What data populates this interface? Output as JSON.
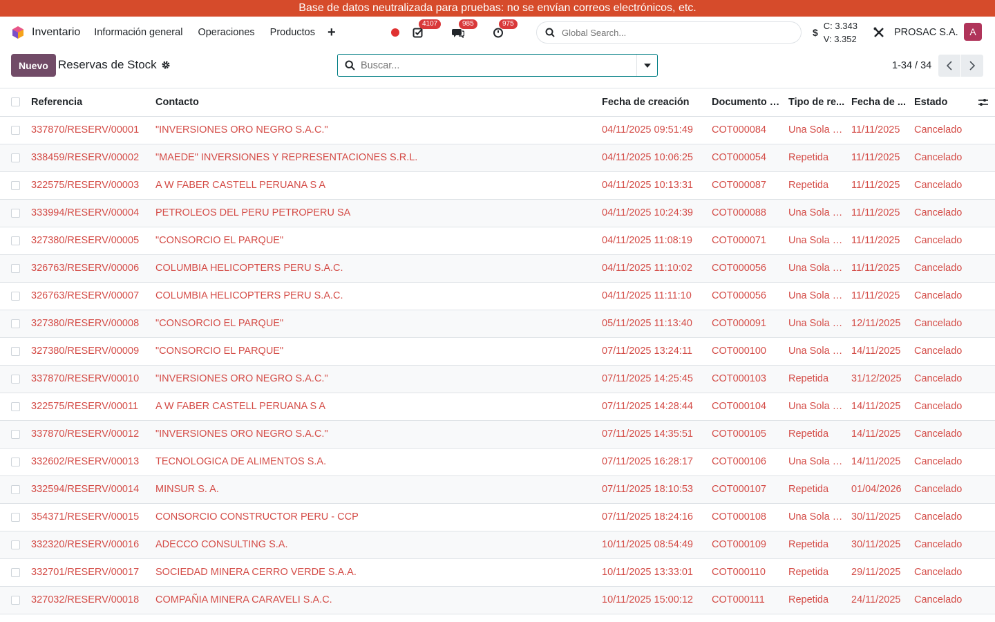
{
  "banner": "Base de datos neutralizada para pruebas: no se envían correos electrónicos, etc.",
  "navbar": {
    "app_name": "Inventario",
    "menu": [
      "Información general",
      "Operaciones",
      "Productos"
    ],
    "activities_badge": "4107",
    "messages_badge": "985",
    "timer_badge": "975",
    "global_search_placeholder": "Global Search...",
    "rate_c": "C: 3.343",
    "rate_v": "V: 3.352",
    "company": "PROSAC S.A.",
    "avatar_letter": "A"
  },
  "control": {
    "new_label": "Nuevo",
    "title": "Reservas de Stock",
    "search_placeholder": "Buscar...",
    "pager": "1-34 / 34"
  },
  "colors": {
    "accent": "#714b67",
    "link_red": "#d44c47",
    "banner": "#d64b2b",
    "teal": "#017e84"
  },
  "table": {
    "headers": [
      "Referencia",
      "Contacto",
      "Fecha de creación",
      "Documento o...",
      "Tipo de re...",
      "Fecha de ...",
      "Estado"
    ],
    "rows": [
      [
        "337870/RESERV/00001",
        "\"INVERSIONES ORO NEGRO S.A.C.\"",
        "04/11/2025 09:51:49",
        "COT000084",
        "Una Sola V...",
        "11/11/2025",
        "Cancelado"
      ],
      [
        "338459/RESERV/00002",
        "\"MAEDE\" INVERSIONES Y REPRESENTACIONES S.R.L.",
        "04/11/2025 10:06:25",
        "COT000054",
        "Repetida",
        "11/11/2025",
        "Cancelado"
      ],
      [
        "322575/RESERV/00003",
        "A W FABER CASTELL PERUANA S A",
        "04/11/2025 10:13:31",
        "COT000087",
        "Repetida",
        "11/11/2025",
        "Cancelado"
      ],
      [
        "333994/RESERV/00004",
        "PETROLEOS DEL PERU PETROPERU SA",
        "04/11/2025 10:24:39",
        "COT000088",
        "Una Sola V...",
        "11/11/2025",
        "Cancelado"
      ],
      [
        "327380/RESERV/00005",
        "\"CONSORCIO EL PARQUE\"",
        "04/11/2025 11:08:19",
        "COT000071",
        "Una Sola V...",
        "11/11/2025",
        "Cancelado"
      ],
      [
        "326763/RESERV/00006",
        "COLUMBIA HELICOPTERS PERU S.A.C.",
        "04/11/2025 11:10:02",
        "COT000056",
        "Una Sola V...",
        "11/11/2025",
        "Cancelado"
      ],
      [
        "326763/RESERV/00007",
        "COLUMBIA HELICOPTERS PERU S.A.C.",
        "04/11/2025 11:11:10",
        "COT000056",
        "Una Sola V...",
        "11/11/2025",
        "Cancelado"
      ],
      [
        "327380/RESERV/00008",
        "\"CONSORCIO EL PARQUE\"",
        "05/11/2025 11:13:40",
        "COT000091",
        "Una Sola V...",
        "12/11/2025",
        "Cancelado"
      ],
      [
        "327380/RESERV/00009",
        "\"CONSORCIO EL PARQUE\"",
        "07/11/2025 13:24:11",
        "COT000100",
        "Una Sola V...",
        "14/11/2025",
        "Cancelado"
      ],
      [
        "337870/RESERV/00010",
        "\"INVERSIONES ORO NEGRO S.A.C.\"",
        "07/11/2025 14:25:45",
        "COT000103",
        "Repetida",
        "31/12/2025",
        "Cancelado"
      ],
      [
        "322575/RESERV/00011",
        "A W FABER CASTELL PERUANA S A",
        "07/11/2025 14:28:44",
        "COT000104",
        "Una Sola V...",
        "14/11/2025",
        "Cancelado"
      ],
      [
        "337870/RESERV/00012",
        "\"INVERSIONES ORO NEGRO S.A.C.\"",
        "07/11/2025 14:35:51",
        "COT000105",
        "Repetida",
        "14/11/2025",
        "Cancelado"
      ],
      [
        "332602/RESERV/00013",
        "TECNOLOGICA DE ALIMENTOS S.A.",
        "07/11/2025 16:28:17",
        "COT000106",
        "Una Sola V...",
        "14/11/2025",
        "Cancelado"
      ],
      [
        "332594/RESERV/00014",
        "MINSUR S. A.",
        "07/11/2025 18:10:53",
        "COT000107",
        "Repetida",
        "01/04/2026",
        "Cancelado"
      ],
      [
        "354371/RESERV/00015",
        "CONSORCIO CONSTRUCTOR PERU - CCP",
        "07/11/2025 18:24:16",
        "COT000108",
        "Una Sola V...",
        "30/11/2025",
        "Cancelado"
      ],
      [
        "332320/RESERV/00016",
        "ADECCO CONSULTING S.A.",
        "10/11/2025 08:54:49",
        "COT000109",
        "Repetida",
        "30/11/2025",
        "Cancelado"
      ],
      [
        "332701/RESERV/00017",
        "SOCIEDAD MINERA CERRO VERDE S.A.A.",
        "10/11/2025 13:33:01",
        "COT000110",
        "Repetida",
        "29/11/2025",
        "Cancelado"
      ],
      [
        "327032/RESERV/00018",
        "COMPAÑIA MINERA CARAVELI S.A.C.",
        "10/11/2025 15:00:12",
        "COT000111",
        "Repetida",
        "24/11/2025",
        "Cancelado"
      ]
    ]
  }
}
